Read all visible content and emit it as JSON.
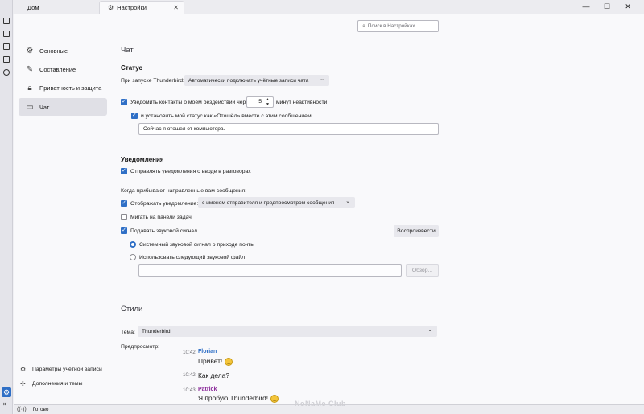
{
  "window": {
    "tabs": [
      {
        "label": "Дом",
        "active": false
      },
      {
        "label": "Настройки",
        "active": true
      }
    ],
    "controls": {
      "minimize": "—",
      "maximize": "☐",
      "close": "✕"
    }
  },
  "spaces_toolbar": {
    "icons": [
      "mail-icon",
      "address-book-icon",
      "calendar-icon",
      "tasks-icon",
      "chat-icon"
    ],
    "settings_icon": "gear-icon"
  },
  "nav": {
    "items": [
      {
        "label": "Основные",
        "icon": "gear-icon"
      },
      {
        "label": "Составление",
        "icon": "pencil-icon"
      },
      {
        "label": "Приватность и защита",
        "icon": "lock-icon"
      },
      {
        "label": "Чат",
        "icon": "chat-icon",
        "active": true
      }
    ],
    "bottom": [
      {
        "label": "Параметры учётной записи",
        "icon": "account-icon"
      },
      {
        "label": "Дополнения и темы",
        "icon": "puzzle-icon"
      }
    ]
  },
  "search": {
    "placeholder": "Поиск в Настройках"
  },
  "main": {
    "section_title": "Чат",
    "status": {
      "heading": "Статус",
      "startup_label": "При запуске Thunderbird:",
      "startup_value": "Автоматически подключать учётные записи чата",
      "idle_checkbox": "Уведомить контакты о моём бездействии через",
      "idle_minutes": "5",
      "idle_suffix": "минут неактивности",
      "away_checkbox": "и установить мой статус как «Отошёл» вместе с этим сообщением:",
      "away_message": "Сейчас я отошел от компьютера."
    },
    "notifications": {
      "heading": "Уведомления",
      "typing_checkbox": "Отправлять уведомления о вводе в разговорах",
      "incoming_label": "Когда прибывают направленные вам сообщения:",
      "show_checkbox": "Отображать уведомление:",
      "show_value": "с именем отправителя и предпросмотром сообщения",
      "flash_checkbox": "Мигать на панели задач",
      "sound_checkbox": "Подавать звуковой сигнал",
      "play_button": "Воспроизвести",
      "sound_system": "Системный звуковой сигнал о приходе почты",
      "sound_custom": "Использовать следующий звуковой файл",
      "browse_button": "Обзор..."
    },
    "styles": {
      "heading": "Стили",
      "theme_label": "Тема:",
      "theme_value": "Thunderbird",
      "preview_label": "Предпросмотр:",
      "messages": [
        {
          "time": "10:42",
          "name": "Florian",
          "name_color": "#2f6fc6",
          "text": "Привет!",
          "emoji": true
        },
        {
          "time": "10:42",
          "name": "",
          "text": "Как дела?",
          "emoji": false
        },
        {
          "time": "10:43",
          "name": "Patrick",
          "name_color": "#8a2a9a",
          "text": "Я пробую Thunderbird!",
          "emoji": true
        }
      ]
    }
  },
  "statusbar": {
    "text": "Готово"
  },
  "watermark": "NoNaMe Club",
  "colors": {
    "accent": "#2f6fc6",
    "background": "#f9f9fb",
    "sidebar": "#e4e4ea"
  }
}
